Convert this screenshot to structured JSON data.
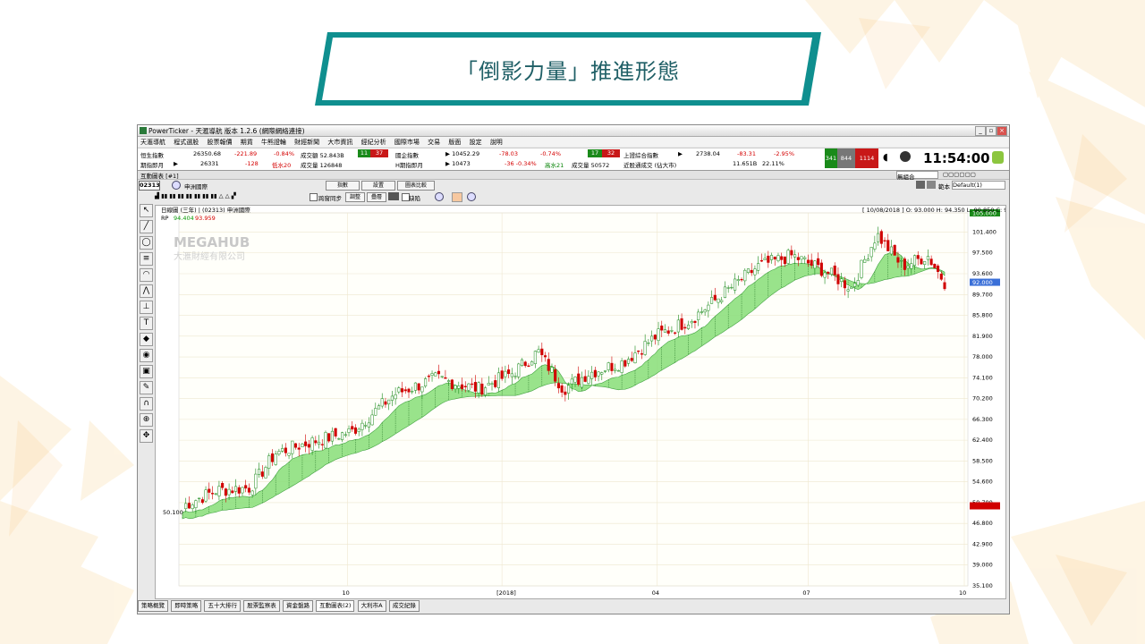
{
  "slide": {
    "title": "「倒影力量」推進形態",
    "colors": {
      "accent": "#1a9a9a",
      "deco": "#f7c06b"
    }
  },
  "app": {
    "window_title": "PowerTicker - 天滙導航 版本 1.2.6 (網際網絡連接)",
    "menu": [
      "天滙導航",
      "程式選股",
      "股票報價",
      "期貨",
      "牛熊證輪",
      "財經新聞",
      "大市資訊",
      "經紀分析",
      "國際市場",
      "交易",
      "版面",
      "設定",
      "說明"
    ],
    "ticker_row1": {
      "hsi_label": "恒生指數",
      "hsi_value": "26350.68",
      "hsi_change": "-221.89",
      "hsi_pct": "-0.84%",
      "turnover_label": "成交額 52.843B",
      "box_up": "11",
      "box_down": "37",
      "hsce_label": "國企指數",
      "hsce_value": "▶ 10452.29",
      "hsce_change": "-78.03",
      "hsce_pct": "-0.74%",
      "box2_up": "17",
      "box2_down": "32",
      "sse_label": "上證綜合指數",
      "sse_value": "2738.04",
      "sse_change": "-83.31",
      "sse_pct": "-2.95%",
      "adv": "341",
      "unch": "844",
      "dec": "1114"
    },
    "ticker_row2": {
      "fut_label": "期指即月",
      "fut_value": "26331",
      "fut_change": "-128",
      "fut_basis": "低水20",
      "fut_vol": "成交量 126848",
      "hfut_label": "H期指即月",
      "hfut_value": "▶ 10473",
      "hfut_change": "-36 -0.34%",
      "hfut_basis": "高水21",
      "hfut_vol": "成交量 50572",
      "near_label": "近股通成交 (佔大市)",
      "near_value": "11.651B",
      "near_pct": "22.11%"
    },
    "clock": "11:54:00",
    "subwindow_title": "互動圖表 [#1]",
    "code_input": "02313",
    "stock_name": "申洲國際",
    "btn_indicator": "指數",
    "btn_period": "設置",
    "btn_compare": "圖表比較",
    "toggle_sync": "跨窗同步",
    "btn_adjust": "調整",
    "btn_overlay": "疊層",
    "toggle_gap": "缺陷",
    "right_select": "無組合",
    "layout_label": "範本",
    "layout_value": "Default(1)",
    "chart_header": "日線圖 (三年) | (02313) 申洲國際",
    "chart_ohlc": "[ 10/08/2018 ]  O: 93.000  H: 94.350  L: 90.850  C: 92.000",
    "rp_label": "RP",
    "rp_v1": "94.404",
    "rp_v2": "93.959",
    "watermark1": "MEGAHUB",
    "watermark2": "大滙財經有限公司",
    "low_label": "50.100",
    "bottom_tabs": [
      "策略概覽",
      "即時策略",
      "五十大排行",
      "股票監察表",
      "資金盤路",
      "互動圖表(2)",
      "大利市A",
      "成交紀錄"
    ]
  },
  "chart_data": {
    "type": "candlestick",
    "ylim": [
      35.1,
      105.0
    ],
    "y_ticks": [
      105.0,
      101.4,
      97.5,
      93.6,
      89.7,
      85.8,
      81.9,
      78.0,
      74.1,
      70.2,
      66.3,
      62.4,
      58.5,
      54.6,
      50.7,
      46.8,
      42.9,
      39.0,
      35.1
    ],
    "x_ticks": [
      "10",
      "[2018]",
      "04",
      "07",
      "10"
    ],
    "last_price": 92.0,
    "current_marker": 50.1,
    "anchor_points": [
      {
        "t": 0,
        "v": 50.1
      },
      {
        "t": 40,
        "v": 53
      },
      {
        "t": 80,
        "v": 53.5
      },
      {
        "t": 110,
        "v": 60
      },
      {
        "t": 150,
        "v": 62
      },
      {
        "t": 200,
        "v": 64
      },
      {
        "t": 250,
        "v": 71
      },
      {
        "t": 300,
        "v": 74
      },
      {
        "t": 350,
        "v": 72
      },
      {
        "t": 390,
        "v": 75
      },
      {
        "t": 420,
        "v": 79
      },
      {
        "t": 450,
        "v": 72
      },
      {
        "t": 480,
        "v": 75
      },
      {
        "t": 520,
        "v": 77
      },
      {
        "t": 560,
        "v": 82
      },
      {
        "t": 600,
        "v": 85
      },
      {
        "t": 640,
        "v": 90
      },
      {
        "t": 680,
        "v": 95
      },
      {
        "t": 720,
        "v": 97
      },
      {
        "t": 760,
        "v": 94
      },
      {
        "t": 790,
        "v": 91
      },
      {
        "t": 820,
        "v": 101
      },
      {
        "t": 850,
        "v": 95
      },
      {
        "t": 880,
        "v": 97
      },
      {
        "t": 900,
        "v": 92
      }
    ]
  }
}
